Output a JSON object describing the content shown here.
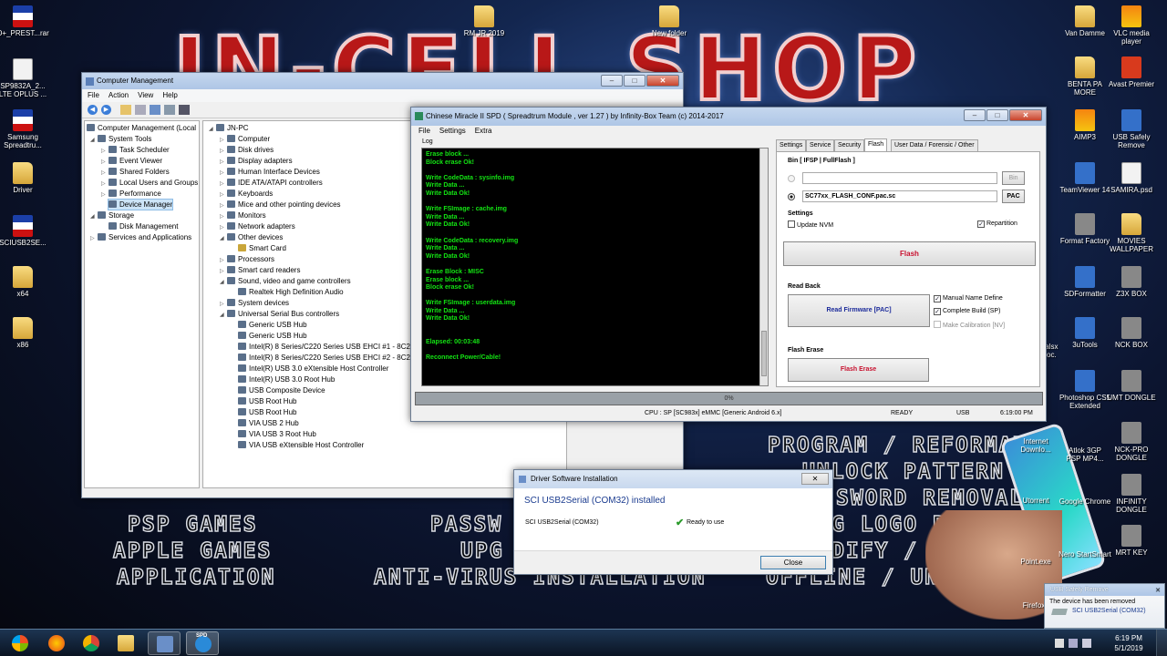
{
  "desktop": {
    "banner_left": "JN-CELL",
    "banner_right": "SHOP",
    "services": [
      "PROGRAM / REFORMAT",
      "UNLOCK PATTERN",
      "SWORD REMOVAL",
      "G LOGO PROBLEM",
      "DIFY / JAILBREAK",
      "OFFLINE / UNLOCKING",
      "PSP GAMES",
      "APPLE GAMES",
      "APPLICATION",
      "PASSW",
      "UPG",
      "ANTI-VIRUS INSTALLATION"
    ],
    "icons_left": [
      "O+_PREST...rar",
      "SP9832A_2... LTE OPLUS ...",
      "Samsung Spreadtru...",
      "Driver",
      "SCIUSB2SE...",
      "x64",
      "x86"
    ],
    "icons_top": [
      "RM JR 2019",
      "New folder"
    ],
    "icons_right_a": [
      "Van Damme",
      "BENTA PA MORE",
      "AIMP3",
      "TeamViewer 14",
      "Format Factory",
      "SDFormatter",
      "3uTools",
      "Photoshop CS5 Extended",
      "Internet Downlo...",
      "Utorrent",
      "Nero StartSmart",
      "Point.exe",
      "Firefox"
    ],
    "icons_right_b": [
      "VLC media player",
      "Avast Premier",
      "USB Safely Remove",
      "SAMIRA.psd",
      "MOVIES WALLPAPER",
      "Z3X BOX",
      "NCK BOX",
      "UMT DONGLE",
      "NCK-PRO DONGLE",
      "INFINITY DONGLE",
      "MRT KEY"
    ],
    "misc_labels": [
      "...alsx ...oc.",
      "Atlok 3GP PSP MP4...",
      "Google Chrome"
    ]
  },
  "computer_management": {
    "title": "Computer Management",
    "menu": [
      "File",
      "Action",
      "View",
      "Help"
    ],
    "nav_tree": [
      "Computer Management (Local",
      "System Tools",
      "Task Scheduler",
      "Event Viewer",
      "Shared Folders",
      "Local Users and Groups",
      "Performance",
      "Device Manager",
      "Storage",
      "Disk Management",
      "Services and Applications"
    ],
    "device_tree": [
      "JN-PC",
      "Computer",
      "Disk drives",
      "Display adapters",
      "Human Interface Devices",
      "IDE ATA/ATAPI controllers",
      "Keyboards",
      "Mice and other pointing devices",
      "Monitors",
      "Network adapters",
      "Other devices",
      "Smart Card",
      "Processors",
      "Smart card readers",
      "Sound, video and game controllers",
      "Realtek High Definition Audio",
      "System devices",
      "Universal Serial Bus controllers",
      "Generic USB Hub",
      "Generic USB Hub",
      "Intel(R) 8 Series/C220 Series USB EHCI #1 - 8C26",
      "Intel(R) 8 Series/C220 Series USB EHCI #2 - 8C2D",
      "Intel(R) USB 3.0 eXtensible Host Controller",
      "Intel(R) USB 3.0 Root Hub",
      "USB Composite Device",
      "USB Root Hub",
      "USB Root Hub",
      "VIA USB 2 Hub",
      "VIA USB 3 Root Hub",
      "VIA USB eXtensible Host Controller"
    ]
  },
  "cm2": {
    "title": "Chinese Miracle II SPD ( Spreadtrum Module , ver 1.27 ) by Infinity-Box Team (c) 2014-2017",
    "menu": [
      "File",
      "Settings",
      "Extra"
    ],
    "log_label": "Log",
    "log_lines": [
      "Erase block ...",
      "Block erase Ok!",
      "",
      "Write CodeData : sysinfo.img",
      "Write Data ...",
      "Write Data Ok!",
      "",
      "Write FSImage : cache.img",
      "Write Data ...",
      "Write Data Ok!",
      "",
      "Write CodeData : recovery.img",
      "Write Data ...",
      "Write Data Ok!",
      "",
      "Erase Block : MISC",
      "Erase block ...",
      "Block erase Ok!",
      "",
      "Write FSImage : userdata.img",
      "Write Data ...",
      "Write Data Ok!",
      "",
      "",
      "Elapsed: 00:03:48",
      "",
      "Reconnect Power/Cable!"
    ],
    "tabs": [
      "Settings",
      "Service",
      "Security",
      "Flash",
      "User Data / Forensic / Other"
    ],
    "bin_group": "Bin  [ IFSP | FullFlash ]",
    "bin_field": "",
    "bin_btn": "Bin",
    "pac_field": "SC77xx_FLASH_CONF.pac.sc",
    "pac_btn": "PAC",
    "settings_group": "Settings",
    "update_nvm": "Update NVM",
    "repartition": "Repartition",
    "flash_btn": "Flash",
    "readback_group": "Read Back",
    "read_btn": "Read Firmware [PAC]",
    "manual_name": "Manual Name Define",
    "complete_build": "Complete Build (SP)",
    "make_calibration": "Make Calibration [NV]",
    "flash_erase_group": "Flash Erase",
    "erase_btn": "Flash Erase",
    "progress_text": "0%",
    "progress": 0,
    "status_cpu": "CPU : SP [SC983x] eMMC [Generic Android 6.x]",
    "status_state": "READY",
    "status_conn": "USB",
    "status_time": "6:19:00 PM"
  },
  "driver_dialog": {
    "title": "Driver Software Installation",
    "heading": "SCI USB2Serial (COM32) installed",
    "device": "SCI USB2Serial (COM32)",
    "status": "Ready to use",
    "close": "Close"
  },
  "usb_popup": {
    "title": "USB Safely Remove",
    "message": "The device has been removed",
    "device": "SCI USB2Serial (COM32)"
  },
  "taskbar": {
    "spd_label": "SPD",
    "time": "6:19 PM",
    "date": "5/1/2019"
  }
}
